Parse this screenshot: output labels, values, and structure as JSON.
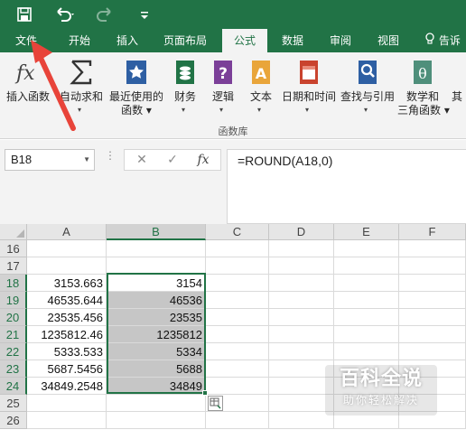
{
  "colors": {
    "brand": "#217346",
    "ribbon_bg": "#f3f3f3",
    "selection_fill": "#c6c6c6",
    "annotation_arrow": "#e8443a"
  },
  "quick_access": {
    "icons": [
      "save-icon",
      "undo-icon",
      "redo-icon",
      "customize-icon"
    ]
  },
  "tabs": [
    "文件",
    "开始",
    "插入",
    "页面布局",
    "公式",
    "数据",
    "审阅",
    "视图"
  ],
  "active_tab": "公式",
  "tell_me": "告诉",
  "ribbon": {
    "buttons": [
      {
        "label": "插入函数",
        "icon": "insert-function-icon"
      },
      {
        "label": "自动求和",
        "icon": "sigma-icon"
      },
      {
        "label1": "最近使用的",
        "label2": "函数",
        "icon": "recently-used-icon"
      },
      {
        "label": "财务",
        "icon": "financial-icon"
      },
      {
        "label": "逻辑",
        "icon": "logical-icon"
      },
      {
        "label": "文本",
        "icon": "text-icon"
      },
      {
        "label": "日期和时间",
        "icon": "date-time-icon"
      },
      {
        "label": "查找与引用",
        "icon": "lookup-icon"
      },
      {
        "label1": "数学和",
        "label2": "三角函数",
        "icon": "math-trig-icon"
      },
      {
        "label": "其",
        "icon": "more-functions-icon"
      }
    ],
    "group_label": "函数库"
  },
  "formula_bar": {
    "name_box": "B18",
    "formula": "=ROUND(A18,0)",
    "fx_label": "fx"
  },
  "grid": {
    "columns": [
      "A",
      "B",
      "C",
      "D",
      "E",
      "F"
    ],
    "rows": [
      {
        "num": "16",
        "a": "",
        "b": ""
      },
      {
        "num": "17",
        "a": "",
        "b": ""
      },
      {
        "num": "18",
        "a": "3153.663",
        "b": "3154"
      },
      {
        "num": "19",
        "a": "46535.644",
        "b": "46536"
      },
      {
        "num": "20",
        "a": "23535.456",
        "b": "23535"
      },
      {
        "num": "21",
        "a": "1235812.46",
        "b": "1235812"
      },
      {
        "num": "22",
        "a": "5333.533",
        "b": "5334"
      },
      {
        "num": "23",
        "a": "5687.5456",
        "b": "5688"
      },
      {
        "num": "24",
        "a": "34849.2548",
        "b": "34849"
      },
      {
        "num": "25",
        "a": "",
        "b": ""
      },
      {
        "num": "26",
        "a": "",
        "b": ""
      }
    ],
    "selected_rows": [
      "18",
      "19",
      "20",
      "21",
      "22",
      "23",
      "24"
    ]
  },
  "watermark": {
    "title": "百科全说",
    "subtitle": "助你轻松解决"
  }
}
